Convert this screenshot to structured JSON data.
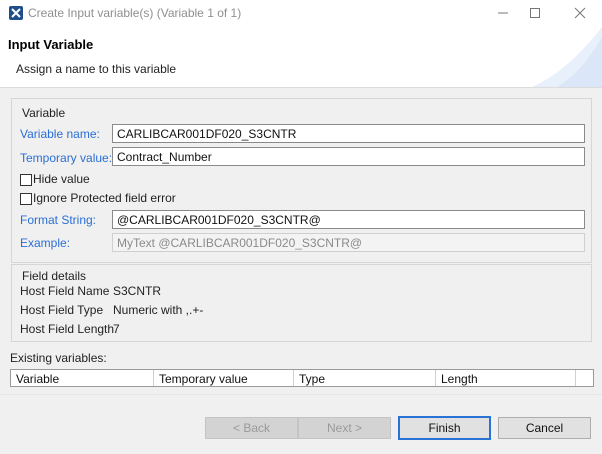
{
  "window": {
    "title": "Create Input variable(s) (Variable 1 of 1)",
    "app_icon": "app-logo-icon"
  },
  "header": {
    "heading": "Input Variable",
    "subtitle": "Assign a name to this variable"
  },
  "variable_group": {
    "title": "Variable",
    "variable_name_label": "Variable name:",
    "variable_name_value": "CARLIBCAR001DF020_S3CNTR",
    "temporary_value_label": "Temporary value:",
    "temporary_value_value": "Contract_Number",
    "hide_value_label": "Hide value",
    "hide_value_checked": false,
    "ignore_protected_label": "Ignore Protected field error",
    "ignore_protected_checked": false,
    "format_string_label": "Format String:",
    "format_string_value": "@CARLIBCAR001DF020_S3CNTR@",
    "example_label": "Example:",
    "example_value": "MyText @CARLIBCAR001DF020_S3CNTR@"
  },
  "field_details": {
    "title": "Field details",
    "host_field_name_label": "Host Field Name",
    "host_field_name_value": "S3CNTR",
    "host_field_type_label": "Host Field Type",
    "host_field_type_value": "Numeric with ,.+-",
    "host_field_length_label": "Host Field Length",
    "host_field_length_value": "7"
  },
  "existing_variables": {
    "label": "Existing variables:",
    "columns": [
      "Variable",
      "Temporary value",
      "Type",
      "Length"
    ]
  },
  "footer": {
    "back_label": "< Back",
    "next_label": "Next >",
    "finish_label": "Finish",
    "cancel_label": "Cancel"
  },
  "colors": {
    "label_blue": "#2a6fd6",
    "default_button_border": "#2a73d6"
  }
}
